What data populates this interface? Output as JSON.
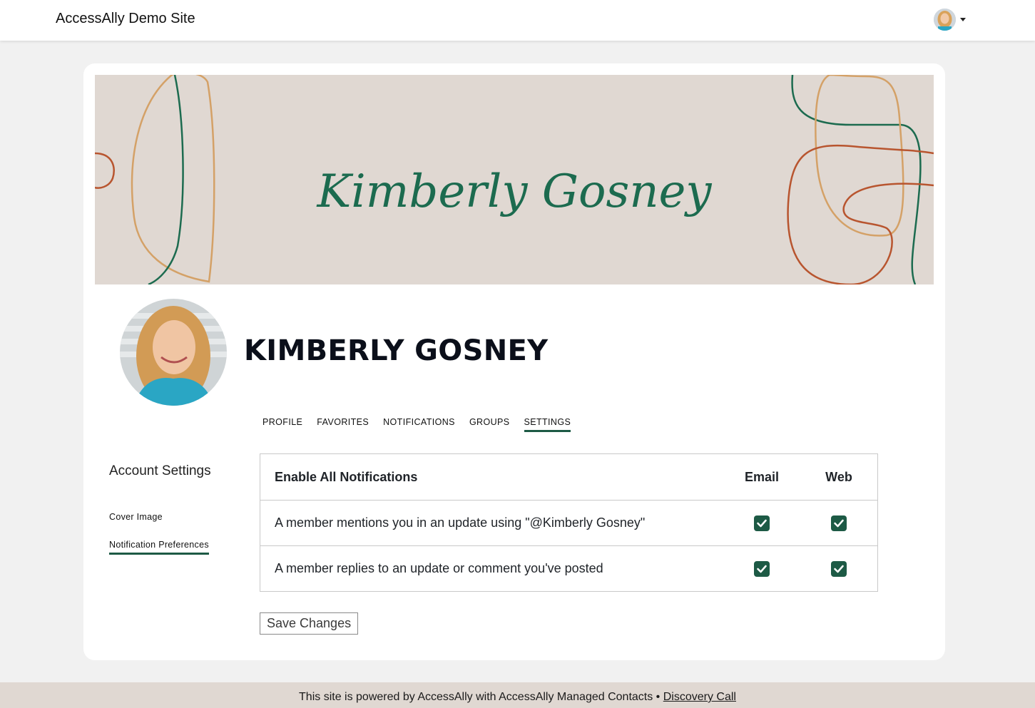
{
  "header": {
    "site_title": "AccessAlly Demo Site",
    "user_menu_icon": "user-avatar",
    "caret_icon": "caret-down-icon"
  },
  "profile": {
    "cover_signature": "Kimberly Gosney",
    "name": "KIMBERLY GOSNEY",
    "tabs": [
      {
        "label": "PROFILE",
        "active": false
      },
      {
        "label": "FAVORITES",
        "active": false
      },
      {
        "label": "NOTIFICATIONS",
        "active": false
      },
      {
        "label": "GROUPS",
        "active": false
      },
      {
        "label": "SETTINGS",
        "active": true
      }
    ]
  },
  "sidebar": {
    "title": "Account Settings",
    "items": [
      {
        "label": "Cover Image",
        "active": false
      },
      {
        "label": "Notification Preferences",
        "active": true
      }
    ]
  },
  "notifications": {
    "header": {
      "label": "Enable All Notifications",
      "email": "Email",
      "web": "Web"
    },
    "rows": [
      {
        "label": "A member mentions you in an update using \"@Kimberly Gosney\"",
        "email": true,
        "web": true
      },
      {
        "label": "A member replies to an update or comment you've posted",
        "email": true,
        "web": true
      }
    ]
  },
  "save_button": "Save Changes",
  "footer": {
    "text": "This site is powered by AccessAlly with AccessAlly Managed Contacts •",
    "link": "Discovery Call"
  },
  "colors": {
    "accent": "#1d5a45",
    "cover_bg": "#e0d8d2",
    "page_bg": "#f1f1f1"
  }
}
